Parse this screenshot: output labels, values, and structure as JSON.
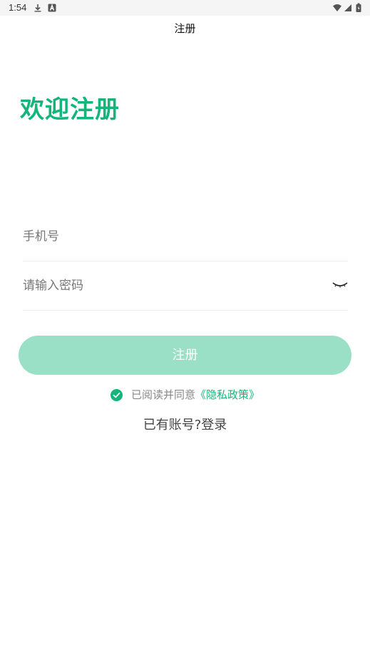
{
  "status_bar": {
    "time": "1:54",
    "icons": [
      "download-icon",
      "a-badge-icon",
      "wifi-icon",
      "signal-icon",
      "battery-icon"
    ]
  },
  "nav": {
    "title": "注册"
  },
  "welcome": "欢迎注册",
  "form": {
    "phone_placeholder": "手机号",
    "password_placeholder": "请输入密码",
    "register_label": "注册"
  },
  "agreement": {
    "checked": true,
    "text": "已阅读并同意",
    "policy_link": "《隐私政策》"
  },
  "login_prompt": "已有账号?登录",
  "colors": {
    "accent": "#13b57a",
    "button_bg": "#99e0c6",
    "status_bar_bg": "#f5f5f5"
  }
}
